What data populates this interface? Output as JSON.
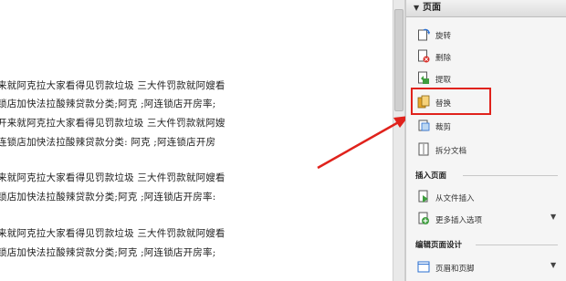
{
  "document": {
    "lines": [
      "来就阿克拉大家看得见罚款垃圾  三大件罚款就阿嫂看",
      "锁店加快法拉酸辣贷款分类;阿克 ;阿连锁店开房率;",
      "开来就阿克拉大家看得见罚款垃圾  三大件罚款就阿嫂",
      "连锁店加快法拉酸辣贷款分类: 阿克 ;阿连锁店开房",
      "来就阿克拉大家看得见罚款垃圾  三大件罚款就阿嫂看",
      "锁店加快法拉酸辣贷款分类;阿克 ;阿连锁店开房率:",
      "来就阿克拉大家看得见罚款垃圾  三大件罚款就阿嫂看",
      "锁店加快法拉酸辣贷款分类;阿克 ;阿连锁店开房率;"
    ]
  },
  "panel": {
    "header": "页面",
    "items": [
      {
        "label": "旋转",
        "icon": "rotate-icon"
      },
      {
        "label": "删除",
        "icon": "delete-page-icon"
      },
      {
        "label": "提取",
        "icon": "extract-icon"
      },
      {
        "label": "替换",
        "icon": "replace-icon"
      },
      {
        "label": "裁剪",
        "icon": "crop-icon"
      },
      {
        "label": "拆分文档",
        "icon": "split-document-icon"
      }
    ],
    "insert_section": {
      "title": "插入页面",
      "items": [
        {
          "label": "从文件插入",
          "icon": "insert-from-file-icon"
        },
        {
          "label": "更多插入选项",
          "icon": "more-insert-options-icon"
        }
      ]
    },
    "edit_section": {
      "title": "编辑页面设计",
      "items": [
        {
          "label": "页眉和页脚",
          "icon": "header-footer-icon"
        }
      ]
    }
  },
  "annotation": {
    "highlight_color": "#e0221c"
  }
}
